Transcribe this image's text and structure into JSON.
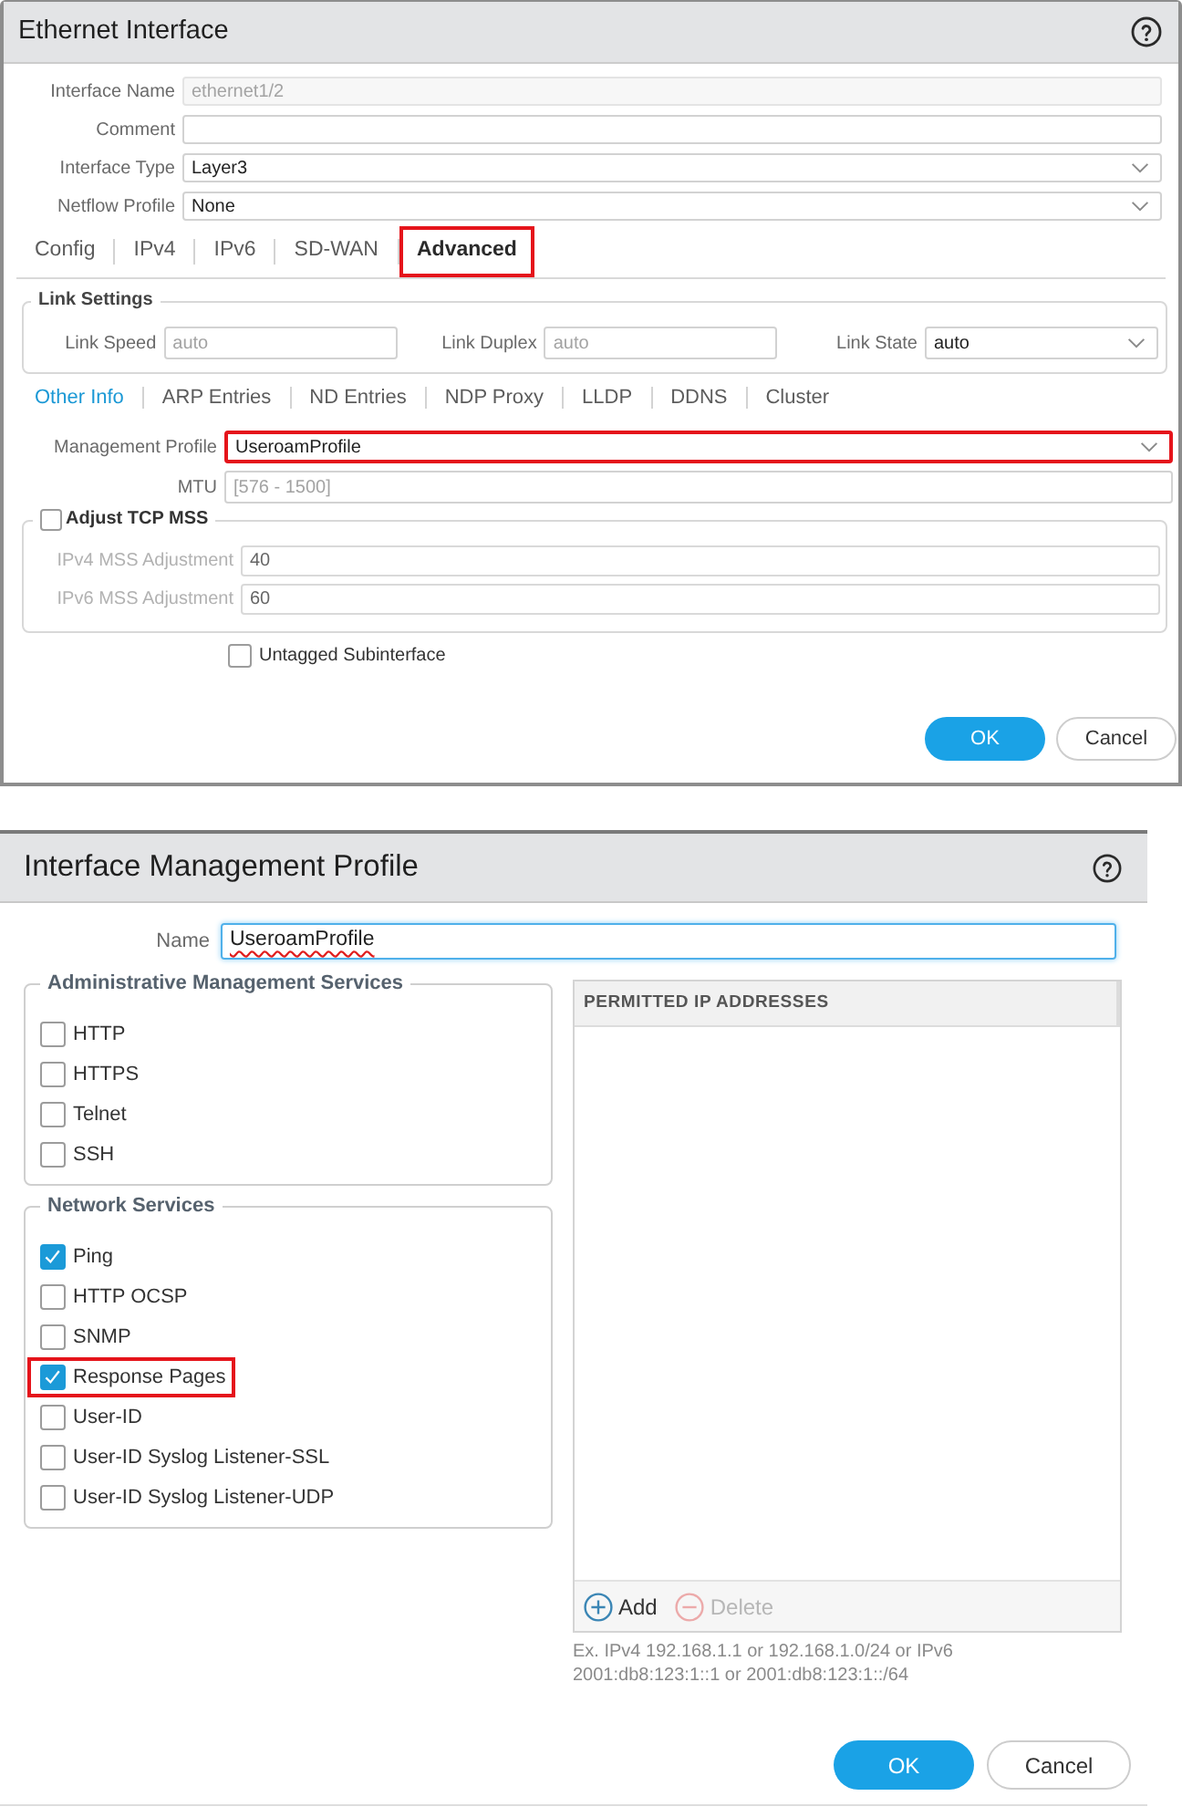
{
  "ethernet_dialog": {
    "title": "Ethernet Interface",
    "fields": [
      {
        "label": "Interface Name",
        "kind": "text",
        "value": "ethernet1/2",
        "disabled": true
      },
      {
        "label": "Comment",
        "kind": "text",
        "disabled": false
      },
      {
        "label": "Interface Type",
        "kind": "select",
        "value": "Layer3",
        "disabled": false
      },
      {
        "label": "Netflow Profile",
        "kind": "select",
        "value": "None",
        "disabled": false
      }
    ],
    "tabs": [
      {
        "label": "Config",
        "selected": false,
        "highlighted": false
      },
      {
        "label": "IPv4",
        "selected": false,
        "highlighted": false
      },
      {
        "label": "IPv6",
        "selected": false,
        "highlighted": false
      },
      {
        "label": "SD-WAN",
        "selected": false,
        "highlighted": false
      },
      {
        "label": "Advanced",
        "selected": true,
        "highlighted": true
      }
    ],
    "link_settings": {
      "title": "Link Settings",
      "fields": [
        {
          "label": "Link Speed",
          "kind": "text",
          "placeholder": "auto"
        },
        {
          "label": "Link Duplex",
          "kind": "text",
          "placeholder": "auto"
        },
        {
          "label": "Link State",
          "kind": "select",
          "value": "auto"
        }
      ]
    },
    "sub_tabs": [
      {
        "label": "Other Info",
        "selected": true
      },
      {
        "label": "ARP Entries",
        "selected": false
      },
      {
        "label": "ND Entries",
        "selected": false
      },
      {
        "label": "NDP Proxy",
        "selected": false
      },
      {
        "label": "LLDP",
        "selected": false
      },
      {
        "label": "DDNS",
        "selected": false
      },
      {
        "label": "Cluster",
        "selected": false
      }
    ],
    "other_info_fields": [
      {
        "label": "Management Profile",
        "kind": "select",
        "value": "UseroamProfile",
        "highlighted": true
      },
      {
        "label": "MTU",
        "kind": "text",
        "placeholder": "[576 - 1500]",
        "highlighted": false
      }
    ],
    "adjust_tcp_mss": {
      "label": "Adjust TCP MSS",
      "checked": false,
      "fields": [
        {
          "label": "IPv4 MSS Adjustment",
          "value": "40"
        },
        {
          "label": "IPv6 MSS Adjustment",
          "value": "60"
        }
      ]
    },
    "untagged_subinterface": {
      "label": "Untagged Subinterface",
      "checked": false
    },
    "buttons": [
      {
        "label": "OK",
        "kind": "primary"
      },
      {
        "label": "Cancel",
        "kind": "secondary"
      }
    ]
  },
  "profile_dialog": {
    "title": "Interface Management Profile",
    "name_field": {
      "label": "Name",
      "value": "UseroamProfile",
      "focused": true
    },
    "groups": [
      {
        "title": "Administrative Management Services",
        "items": [
          {
            "label": "HTTP",
            "checked": false,
            "highlighted": false
          },
          {
            "label": "HTTPS",
            "checked": false,
            "highlighted": false
          },
          {
            "label": "Telnet",
            "checked": false,
            "highlighted": false
          },
          {
            "label": "SSH",
            "checked": false,
            "highlighted": false
          }
        ]
      },
      {
        "title": "Network Services",
        "items": [
          {
            "label": "Ping",
            "checked": true,
            "highlighted": false
          },
          {
            "label": "HTTP OCSP",
            "checked": false,
            "highlighted": false
          },
          {
            "label": "SNMP",
            "checked": false,
            "highlighted": false
          },
          {
            "label": "Response Pages",
            "checked": true,
            "highlighted": true
          },
          {
            "label": "User-ID",
            "checked": false,
            "highlighted": false
          },
          {
            "label": "User-ID Syslog Listener-SSL",
            "checked": false,
            "highlighted": false
          },
          {
            "label": "User-ID Syslog Listener-UDP",
            "checked": false,
            "highlighted": false
          }
        ]
      }
    ],
    "permitted_ip_addresses": {
      "header": "PERMITTED IP ADDRESSES",
      "actions": [
        {
          "label": "Add",
          "kind": "add",
          "disabled": false
        },
        {
          "label": "Delete",
          "kind": "delete",
          "disabled": true
        }
      ],
      "hint_lines": [
        "Ex. IPv4 192.168.1.1 or 192.168.1.0/24 or IPv6",
        "2001:db8:123:1::1 or 2001:db8:123:1::/64"
      ]
    },
    "buttons": [
      {
        "label": "OK",
        "kind": "primary"
      },
      {
        "label": "Cancel",
        "kind": "secondary"
      }
    ]
  }
}
